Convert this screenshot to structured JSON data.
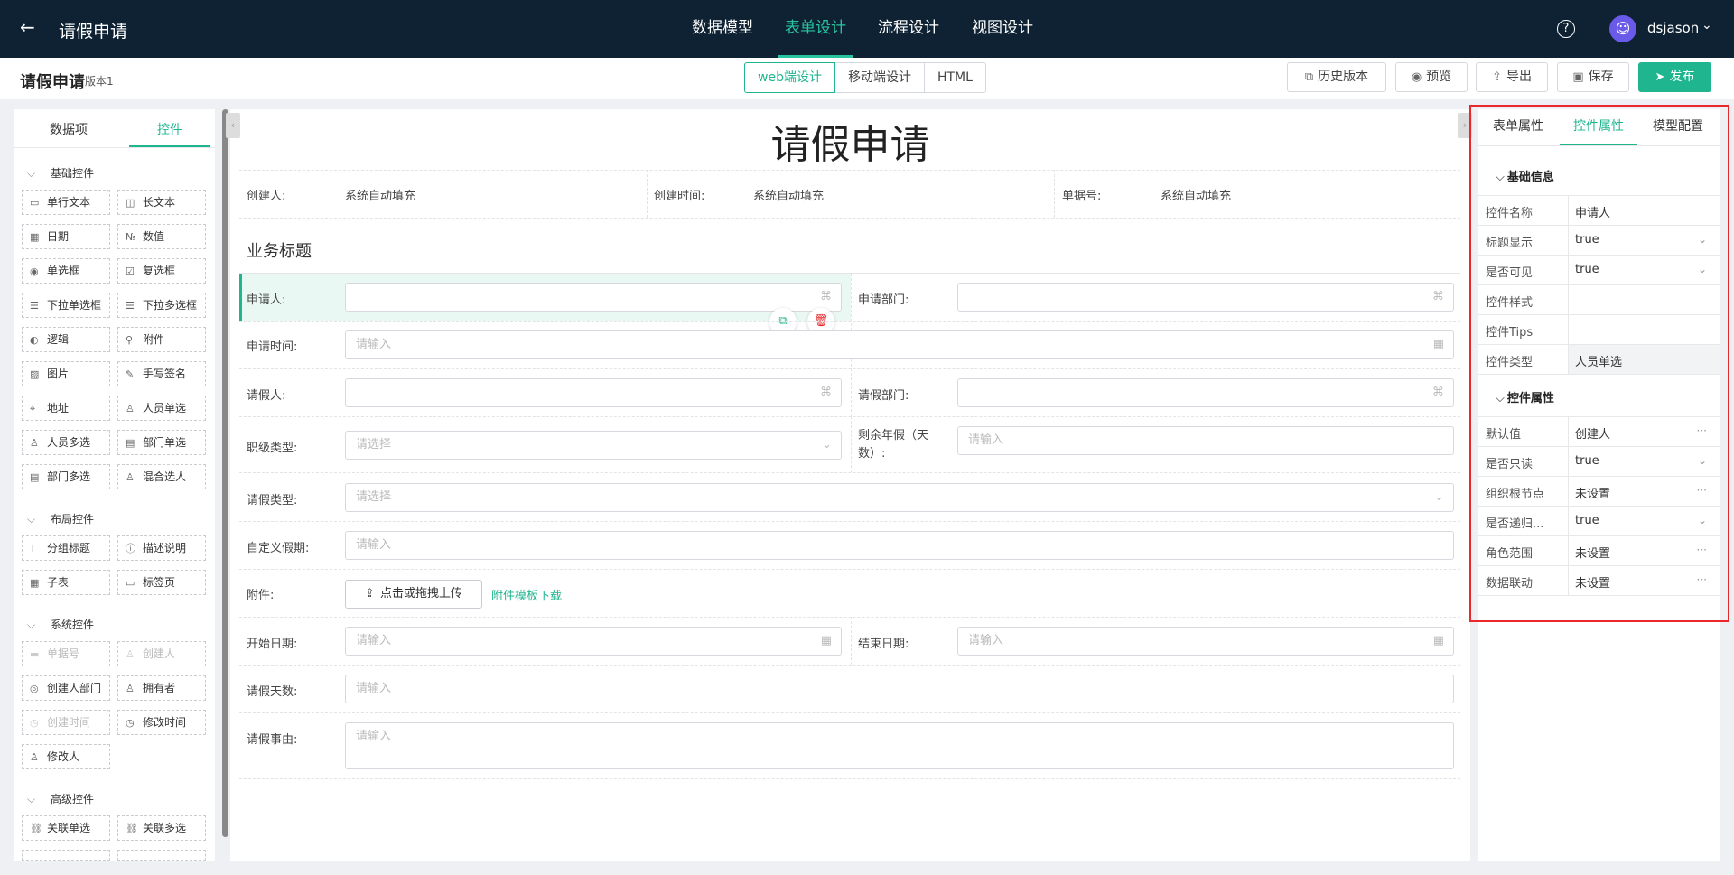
{
  "topbar": {
    "back_icon": "arrow-left-icon",
    "title": "请假申请",
    "tabs": [
      {
        "label": "数据模型"
      },
      {
        "label": "表单设计",
        "active": true
      },
      {
        "label": "流程设计"
      },
      {
        "label": "视图设计"
      }
    ],
    "help_icon": "help-circle-icon",
    "help_glyph": "?",
    "username": "dsjason",
    "avatar_glyph": "☺"
  },
  "subheader": {
    "title": "请假申请",
    "version": "版本1",
    "modes": [
      "web端设计",
      "移动端设计",
      "HTML"
    ],
    "buttons": {
      "history": "历史版本",
      "preview": "预览",
      "export": "导出",
      "save": "保存",
      "publish": "发布"
    }
  },
  "left": {
    "tabs": [
      "数据项",
      "控件"
    ],
    "sections": {
      "basic": "基础控件",
      "layout": "布局控件",
      "system": "系统控件",
      "advanced": "高级控件"
    },
    "basic": [
      "单行文本",
      "长文本",
      "日期",
      "数值",
      "单选框",
      "复选框",
      "下拉单选框",
      "下拉多选框",
      "逻辑",
      "附件",
      "图片",
      "手写签名",
      "地址",
      "人员单选",
      "人员多选",
      "部门单选",
      "部门多选",
      "混合选人"
    ],
    "layout": [
      "分组标题",
      "描述说明",
      "子表",
      "标签页"
    ],
    "system": [
      "单据号",
      "创建人",
      "创建人部门",
      "拥有者",
      "创建时间",
      "修改时间",
      "修改人"
    ],
    "advanced": [
      "关联单选",
      "关联多选"
    ]
  },
  "form": {
    "title": "请假申请",
    "meta": {
      "creator_label": "创建人:",
      "creator_value": "系统自动填充",
      "created_label": "创建时间:",
      "created_value": "系统自动填充",
      "docno_label": "单据号:",
      "docno_value": "系统自动填充"
    },
    "section_title": "业务标题",
    "fields": {
      "applicant": "申请人:",
      "apply_dept": "申请部门:",
      "apply_time": "申请时间:",
      "leave_person": "请假人:",
      "leave_dept": "请假部门:",
      "job_type": "职级类型:",
      "remaining": "剩余年假（天数）:",
      "leave_type": "请假类型:",
      "custom_period": "自定义假期:",
      "attachment": "附件:",
      "start_date": "开始日期:",
      "end_date": "结束日期:",
      "leave_days": "请假天数:",
      "reason": "请假事由:"
    },
    "placeholders": {
      "input": "请输入",
      "select": "请选择"
    },
    "upload_label": "点击或拖拽上传",
    "template_link": "附件模板下载"
  },
  "right": {
    "tabs": [
      "表单属性",
      "控件属性",
      "模型配置"
    ],
    "basic_section": "基础信息",
    "basic": [
      {
        "label": "控件名称",
        "value": "申请人"
      },
      {
        "label": "标题显示",
        "value": "true",
        "icon": "chevron-down-icon"
      },
      {
        "label": "是否可见",
        "value": "true",
        "icon": "chevron-down-icon"
      },
      {
        "label": "控件样式",
        "value": ""
      },
      {
        "label": "控件Tips",
        "value": ""
      },
      {
        "label": "控件类型",
        "value": "人员单选",
        "gray": true
      }
    ],
    "prop_section": "控件属性",
    "props": [
      {
        "label": "默认值",
        "value": "创建人",
        "icon": "more-icon"
      },
      {
        "label": "是否只读",
        "value": "true",
        "icon": "chevron-down-icon"
      },
      {
        "label": "组织根节点",
        "value": "未设置",
        "icon": "more-icon"
      },
      {
        "label": "是否递归...",
        "value": "true",
        "icon": "chevron-down-icon"
      },
      {
        "label": "角色范围",
        "value": "未设置",
        "icon": "more-icon"
      },
      {
        "label": "数据联动",
        "value": "未设置",
        "icon": "more-icon"
      }
    ]
  },
  "colors": {
    "topbar": "#0e2233",
    "accent": "#1fb58f",
    "highlight": "#e9f8f2",
    "danger": "#e8282b"
  }
}
